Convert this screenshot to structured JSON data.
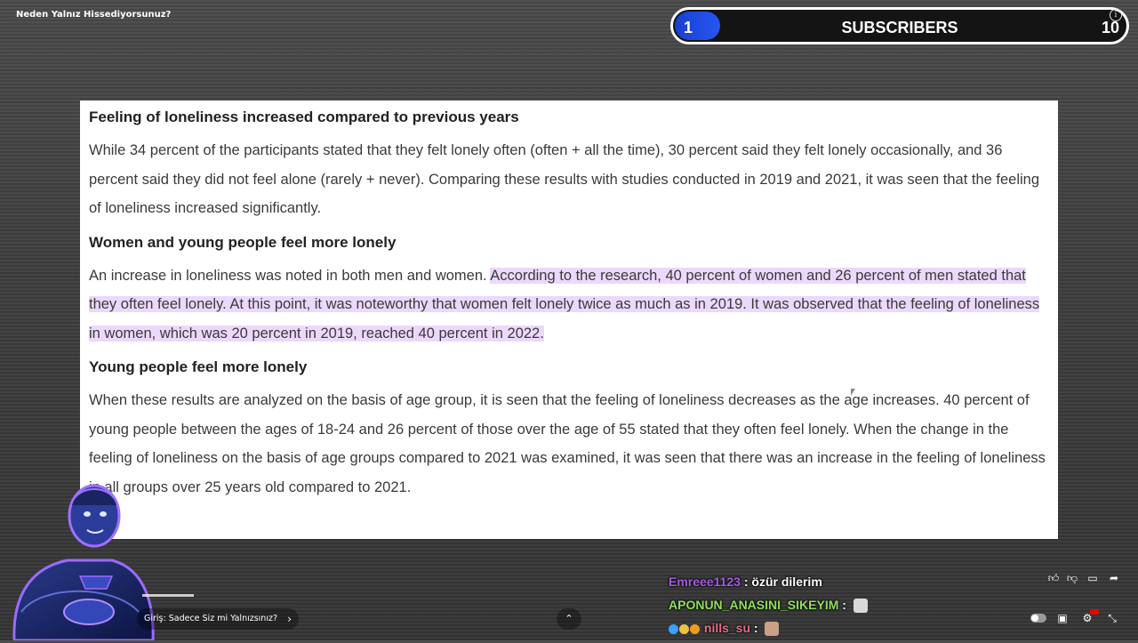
{
  "video": {
    "title": "Neden Yalnız Hissediyorsunuz?"
  },
  "subscriber_goal": {
    "current": "1",
    "label": "SUBSCRIBERS",
    "goal": "10",
    "progress_fraction": 0.1,
    "fill_color": "#2457f5"
  },
  "article": {
    "sections": [
      {
        "heading": "Feeling of loneliness increased compared to previous years",
        "body": "While 34 percent of the participants stated that they felt lonely often (often + all the time), 30 percent said they felt lonely occasionally, and 36 percent said they did not feel alone (rarely + never). Comparing these results with studies conducted in 2019 and 2021, it was seen that the feeling of loneliness increased significantly."
      },
      {
        "heading": "Women and young people feel more lonely",
        "body": "An increase in loneliness was noted in both men and women. ",
        "highlighted": "According to the research, 40 percent of women and 26 percent of men stated that they often feel lonely. At this point, it was noteworthy that women felt lonely twice as much as in 2019. It was observed that the feeling of loneliness in women, which was 20 percent in 2019, reached 40 percent in 2022."
      },
      {
        "heading": "Young people feel more lonely",
        "body": "When these results are analyzed on the basis of age group, it is seen that the feeling of loneliness decreases as the age increases. 40 percent of young people between the ages of 18-24 and 26 percent of those over the age of 55 stated that they often feel lonely. When the change in the feeling of loneliness on the basis of age groups compared to 2021 was examined, it was seen that there was an increase in the feeling of loneliness in all groups over 25 years old compared to 2021."
      }
    ],
    "highlight_color": "#ecd8fb"
  },
  "player": {
    "chapter_label": "Giriş: Sadece Siz mi Yalnızsınız?",
    "chapter_progress_fraction": 1.0,
    "icons": [
      "like-icon",
      "dislike-icon",
      "comment-icon",
      "share-icon",
      "autoplay-toggle",
      "subtitles-icon",
      "settings-icon",
      "fullscreen-exit-icon",
      "expand-up-icon"
    ]
  },
  "chat": {
    "messages": [
      {
        "user": "Emreee1123",
        "user_color": "#a45ce0",
        "sep": " : ",
        "text": "özür dilerim",
        "emote": ""
      },
      {
        "user": "APONUN_ANASINI_SIKEYIM",
        "user_color": "#8fe05c",
        "sep": " : ",
        "text": "",
        "emote": "face-emote"
      },
      {
        "user": "nills_su",
        "user_color": "#e0708a",
        "sep": " : ",
        "text": "",
        "emote": "face-emote"
      }
    ]
  }
}
